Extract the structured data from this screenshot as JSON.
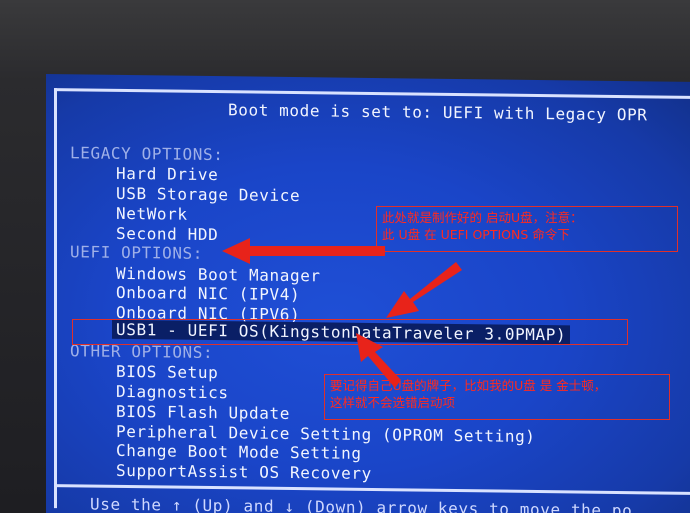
{
  "bios": {
    "header": "Boot mode is set to: UEFI with Legacy OPR",
    "legacy_label": "LEGACY OPTIONS:",
    "legacy_items": [
      "Hard Drive",
      "USB Storage Device",
      "NetWork",
      "Second HDD"
    ],
    "uefi_label": "UEFI OPTIONS:",
    "uefi_items": [
      "Windows Boot Manager",
      "Onboard NIC (IPV4)",
      "Onboard NIC (IPV6)"
    ],
    "uefi_selected": "USB1 - UEFI OS(KingstonDataTraveler 3.0PMAP)",
    "other_label": "OTHER OPTIONS:",
    "other_items": [
      "BIOS Setup",
      "Diagnostics",
      "BIOS Flash Update",
      "Peripheral Device Setting (OPROM Setting)",
      "Change Boot Mode Setting",
      "SupportAssist OS Recovery"
    ],
    "footer_hint": "Use the ↑ (Up) and ↓ (Down) arrow keys to move the po"
  },
  "annotations": {
    "note1_line1": "此处就是制作好的 启动U盘，注意：",
    "note1_line2": "此 U盘 在 UEFI OPTIONS  命令下",
    "note2_line1": "要记得自己U盘的牌子，比如我的U盘 是  金士顿，",
    "note2_line2": "这样就不会选错启动项",
    "color": "#ff2a1f"
  },
  "colors": {
    "screen": "#1a45c8",
    "text": "#f2f5ff",
    "frame": "#d9e2ff"
  }
}
